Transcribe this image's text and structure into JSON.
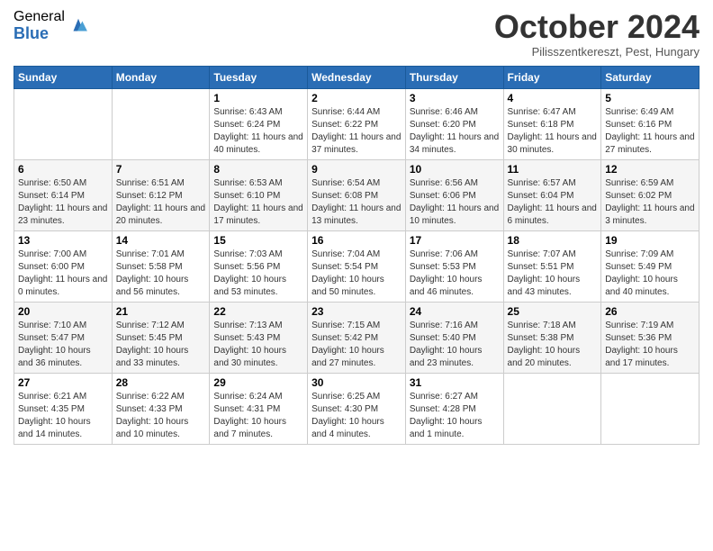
{
  "logo": {
    "general": "General",
    "blue": "Blue"
  },
  "header": {
    "month": "October 2024",
    "location": "Pilisszentkereszt, Pest, Hungary"
  },
  "weekdays": [
    "Sunday",
    "Monday",
    "Tuesday",
    "Wednesday",
    "Thursday",
    "Friday",
    "Saturday"
  ],
  "weeks": [
    [
      {
        "day": "",
        "info": ""
      },
      {
        "day": "",
        "info": ""
      },
      {
        "day": "1",
        "info": "Sunrise: 6:43 AM\nSunset: 6:24 PM\nDaylight: 11 hours and 40 minutes."
      },
      {
        "day": "2",
        "info": "Sunrise: 6:44 AM\nSunset: 6:22 PM\nDaylight: 11 hours and 37 minutes."
      },
      {
        "day": "3",
        "info": "Sunrise: 6:46 AM\nSunset: 6:20 PM\nDaylight: 11 hours and 34 minutes."
      },
      {
        "day": "4",
        "info": "Sunrise: 6:47 AM\nSunset: 6:18 PM\nDaylight: 11 hours and 30 minutes."
      },
      {
        "day": "5",
        "info": "Sunrise: 6:49 AM\nSunset: 6:16 PM\nDaylight: 11 hours and 27 minutes."
      }
    ],
    [
      {
        "day": "6",
        "info": "Sunrise: 6:50 AM\nSunset: 6:14 PM\nDaylight: 11 hours and 23 minutes."
      },
      {
        "day": "7",
        "info": "Sunrise: 6:51 AM\nSunset: 6:12 PM\nDaylight: 11 hours and 20 minutes."
      },
      {
        "day": "8",
        "info": "Sunrise: 6:53 AM\nSunset: 6:10 PM\nDaylight: 11 hours and 17 minutes."
      },
      {
        "day": "9",
        "info": "Sunrise: 6:54 AM\nSunset: 6:08 PM\nDaylight: 11 hours and 13 minutes."
      },
      {
        "day": "10",
        "info": "Sunrise: 6:56 AM\nSunset: 6:06 PM\nDaylight: 11 hours and 10 minutes."
      },
      {
        "day": "11",
        "info": "Sunrise: 6:57 AM\nSunset: 6:04 PM\nDaylight: 11 hours and 6 minutes."
      },
      {
        "day": "12",
        "info": "Sunrise: 6:59 AM\nSunset: 6:02 PM\nDaylight: 11 hours and 3 minutes."
      }
    ],
    [
      {
        "day": "13",
        "info": "Sunrise: 7:00 AM\nSunset: 6:00 PM\nDaylight: 11 hours and 0 minutes."
      },
      {
        "day": "14",
        "info": "Sunrise: 7:01 AM\nSunset: 5:58 PM\nDaylight: 10 hours and 56 minutes."
      },
      {
        "day": "15",
        "info": "Sunrise: 7:03 AM\nSunset: 5:56 PM\nDaylight: 10 hours and 53 minutes."
      },
      {
        "day": "16",
        "info": "Sunrise: 7:04 AM\nSunset: 5:54 PM\nDaylight: 10 hours and 50 minutes."
      },
      {
        "day": "17",
        "info": "Sunrise: 7:06 AM\nSunset: 5:53 PM\nDaylight: 10 hours and 46 minutes."
      },
      {
        "day": "18",
        "info": "Sunrise: 7:07 AM\nSunset: 5:51 PM\nDaylight: 10 hours and 43 minutes."
      },
      {
        "day": "19",
        "info": "Sunrise: 7:09 AM\nSunset: 5:49 PM\nDaylight: 10 hours and 40 minutes."
      }
    ],
    [
      {
        "day": "20",
        "info": "Sunrise: 7:10 AM\nSunset: 5:47 PM\nDaylight: 10 hours and 36 minutes."
      },
      {
        "day": "21",
        "info": "Sunrise: 7:12 AM\nSunset: 5:45 PM\nDaylight: 10 hours and 33 minutes."
      },
      {
        "day": "22",
        "info": "Sunrise: 7:13 AM\nSunset: 5:43 PM\nDaylight: 10 hours and 30 minutes."
      },
      {
        "day": "23",
        "info": "Sunrise: 7:15 AM\nSunset: 5:42 PM\nDaylight: 10 hours and 27 minutes."
      },
      {
        "day": "24",
        "info": "Sunrise: 7:16 AM\nSunset: 5:40 PM\nDaylight: 10 hours and 23 minutes."
      },
      {
        "day": "25",
        "info": "Sunrise: 7:18 AM\nSunset: 5:38 PM\nDaylight: 10 hours and 20 minutes."
      },
      {
        "day": "26",
        "info": "Sunrise: 7:19 AM\nSunset: 5:36 PM\nDaylight: 10 hours and 17 minutes."
      }
    ],
    [
      {
        "day": "27",
        "info": "Sunrise: 6:21 AM\nSunset: 4:35 PM\nDaylight: 10 hours and 14 minutes."
      },
      {
        "day": "28",
        "info": "Sunrise: 6:22 AM\nSunset: 4:33 PM\nDaylight: 10 hours and 10 minutes."
      },
      {
        "day": "29",
        "info": "Sunrise: 6:24 AM\nSunset: 4:31 PM\nDaylight: 10 hours and 7 minutes."
      },
      {
        "day": "30",
        "info": "Sunrise: 6:25 AM\nSunset: 4:30 PM\nDaylight: 10 hours and 4 minutes."
      },
      {
        "day": "31",
        "info": "Sunrise: 6:27 AM\nSunset: 4:28 PM\nDaylight: 10 hours and 1 minute."
      },
      {
        "day": "",
        "info": ""
      },
      {
        "day": "",
        "info": ""
      }
    ]
  ]
}
